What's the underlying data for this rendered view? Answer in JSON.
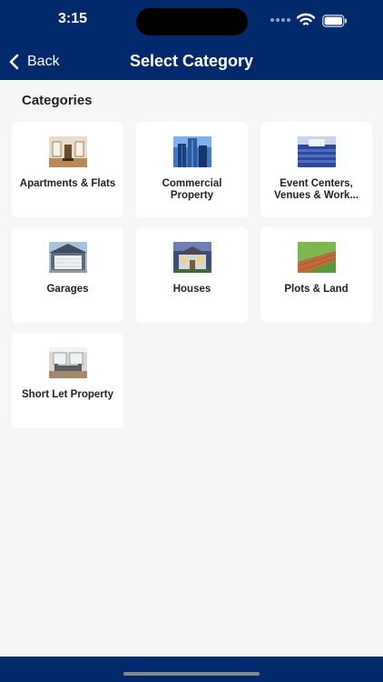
{
  "status_bar": {
    "time": "3:15",
    "icons": [
      "signal-icon",
      "wifi-icon",
      "battery-icon"
    ]
  },
  "header": {
    "back_label": "Back",
    "title": "Select Category"
  },
  "section_title": "Categories",
  "categories": [
    {
      "label": "Apartments & Flats",
      "icon": "apartment-photo"
    },
    {
      "label": "Commercial Property",
      "icon": "commercial-photo"
    },
    {
      "label": "Event Centers, Venues & Work...",
      "icon": "event-center-photo"
    },
    {
      "label": "Garages",
      "icon": "garage-photo"
    },
    {
      "label": "Houses",
      "icon": "house-photo"
    },
    {
      "label": "Plots & Land",
      "icon": "land-photo"
    },
    {
      "label": "Short Let Property",
      "icon": "short-let-photo"
    }
  ],
  "colors": {
    "header": "#002a6b",
    "background": "#f6f6f6",
    "card": "#ffffff"
  }
}
